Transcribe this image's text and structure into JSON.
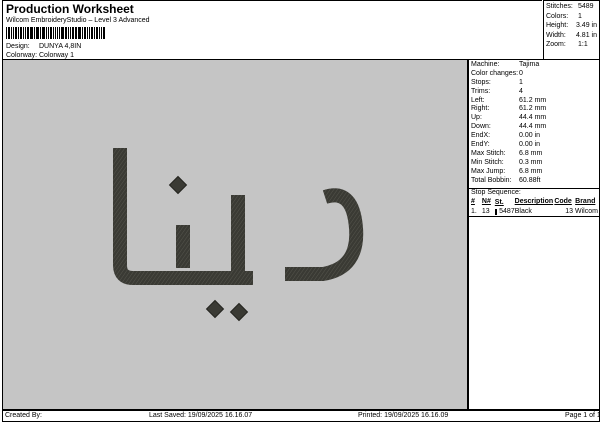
{
  "header": {
    "title": "Production Worksheet",
    "subtitle": "Wilcom EmbroideryStudio – Level 3 Advanced",
    "design_label": "Design:",
    "design_value": "DUNYA 4,8IN",
    "colorway_label": "Colorway:",
    "colorway_value": "Colorway 1"
  },
  "stats": [
    {
      "label": "Stitches:",
      "value": "5489"
    },
    {
      "label": "Colors:",
      "value": "1"
    },
    {
      "label": "Height:",
      "value": "3.49 in"
    },
    {
      "label": "Width:",
      "value": "4.81 in"
    },
    {
      "label": "Zoom:",
      "value": "1:1"
    }
  ],
  "properties": [
    {
      "label": "Machine:",
      "value": "Tajima"
    },
    {
      "label": "Color changes:",
      "value": "0"
    },
    {
      "label": "Stops:",
      "value": "1"
    },
    {
      "label": "Trims:",
      "value": "4"
    },
    {
      "label": "Left:",
      "value": "61.2 mm"
    },
    {
      "label": "Right:",
      "value": "61.2 mm"
    },
    {
      "label": "Up:",
      "value": "44.4 mm"
    },
    {
      "label": "Down:",
      "value": "44.4 mm"
    },
    {
      "label": "EndX:",
      "value": "0.00 in"
    },
    {
      "label": "EndY:",
      "value": "0.00 in"
    },
    {
      "label": "Max Stitch:",
      "value": "6.8 mm"
    },
    {
      "label": "Min Stitch:",
      "value": "0.3 mm"
    },
    {
      "label": "Max Jump:",
      "value": "6.8 mm"
    },
    {
      "label": "Total Bobbin:",
      "value": "60.88ft"
    }
  ],
  "stop_sequence": {
    "title": "Stop Sequence:",
    "headers": {
      "num": "#",
      "n": "N#",
      "st": "St.",
      "desc": "Description",
      "code": "Code",
      "brand": "Brand"
    },
    "rows": [
      {
        "num": "1.",
        "n": "13",
        "st": "5487",
        "desc": "Black",
        "code": "13",
        "brand": "Wilcom",
        "color": "#2e2e2a"
      }
    ]
  },
  "design_colors": {
    "background": "#c5c5c5",
    "thread": "#3a3a34",
    "thread_shade": "#24241f"
  },
  "footer": {
    "created_by": "Created By:",
    "last_saved": "Last Saved: 19/09/2025 16.16.07",
    "printed": "Printed: 19/09/2025 16.16.09",
    "page": "Page 1 of 1"
  }
}
